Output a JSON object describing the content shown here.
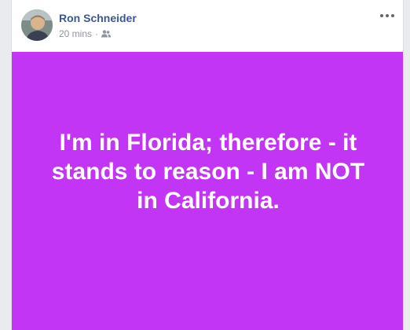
{
  "post": {
    "author": "Ron Schneider",
    "timestamp": "20 mins",
    "separator": "·",
    "audience_icon": "friends-icon",
    "more_icon": "more-options-icon",
    "text": "I'm in Florida; therefore - it stands to reason - I am NOT in California.",
    "background_color": "#c235f5"
  },
  "colors": {
    "author_link": "#365899",
    "meta_text": "#90949c",
    "text": "#ffffff"
  }
}
